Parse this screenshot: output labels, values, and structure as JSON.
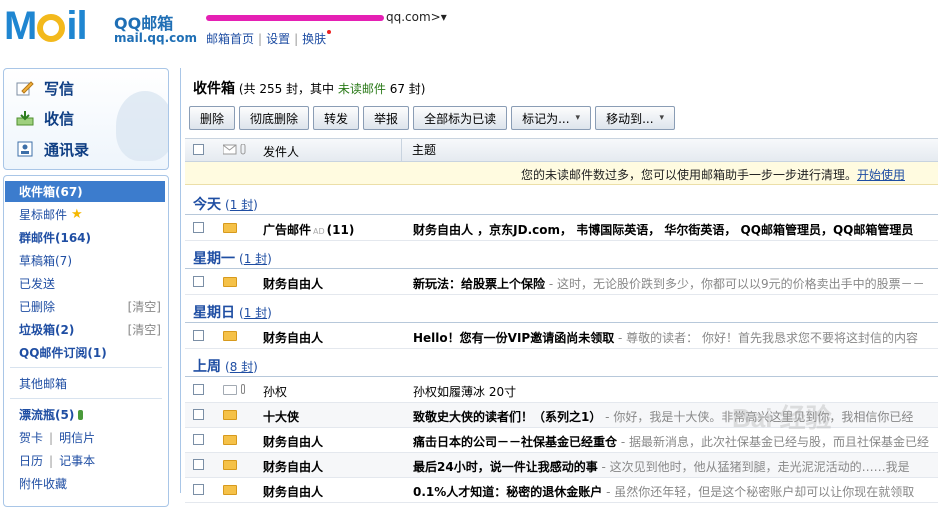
{
  "header": {
    "logo_text": "M  il",
    "logo_sub1": "QQ邮箱",
    "logo_sub2": "mail.qq.com",
    "account_suffix": "qq.com>",
    "account_caret": "▾",
    "links": [
      "邮箱首页",
      "设置",
      "换肤"
    ],
    "link_sep": "|"
  },
  "actions": [
    {
      "label": "写信",
      "icon": "pencil-icon"
    },
    {
      "label": "收信",
      "icon": "inbox-download-icon"
    },
    {
      "label": "通讯录",
      "icon": "address-book-icon"
    }
  ],
  "folders": {
    "inbox": "收件箱(67)",
    "starred": "星标邮件",
    "groups": "群邮件(164)",
    "drafts": "草稿箱(7)",
    "sent": "已发送",
    "deleted": "已删除",
    "spam": "垃圾箱(2)",
    "subscriptions": "QQ邮件订阅(1)",
    "other": "其他邮箱",
    "drift": "漂流瓶(5)",
    "card": "贺卡",
    "postcard": "明信片",
    "calendar": "日历",
    "notes": "记事本",
    "favorites": "附件收藏",
    "clear": "[清空]",
    "sep": "|"
  },
  "main": {
    "title": "收件箱",
    "count_prefix": "(共 255 封，其中",
    "unread_label": "未读邮件",
    "count_suffix": "67 封)"
  },
  "toolbar": {
    "delete": "删除",
    "perm_delete": "彻底删除",
    "forward": "转发",
    "report": "举报",
    "mark_all_read": "全部标为已读",
    "mark_as": "标记为...",
    "move_to": "移动到...",
    "caret": "▾"
  },
  "columns": {
    "sender": "发件人",
    "subject": "主题"
  },
  "notice": {
    "text": "您的未读邮件数过多，您可以使用邮箱助手一步一步进行清理。",
    "link": "开始使用"
  },
  "groups": [
    {
      "name": "今天",
      "count": "1 封"
    },
    {
      "name": "星期一",
      "count": "1 封"
    },
    {
      "name": "星期日",
      "count": "1 封"
    },
    {
      "name": "上周",
      "count": "8 封"
    }
  ],
  "emails": [
    {
      "sender": "广告邮件",
      "ad": "AD",
      "sender_count": "(11)",
      "subject": "财务自由人 ，京东JD.com， 韦博国际英语， 华尔街英语， QQ邮箱管理员，QQ邮箱管理员",
      "preview": ""
    },
    {
      "sender": "财务自由人",
      "subject": "新玩法：给股票上个保险",
      "preview": " - 这时，无论股价跌到多少，你都可以以9元的价格卖出手中的股票－－"
    },
    {
      "sender": "财务自由人",
      "subject": "Hello！您有一份VIP邀请函尚未领取",
      "preview": " - 尊敬的读者： 你好！首先我恳求您不要将这封信的内容"
    },
    {
      "sender": "孙权",
      "subject": "孙权如履薄冰 20寸",
      "preview": ""
    },
    {
      "sender": "十大侠",
      "subject": "致敬史大侠的读者们！（系列之1）",
      "preview": " - 你好，我是十大侠。非常高兴这里见到你，我相信你已经"
    },
    {
      "sender": "财务自由人",
      "subject": "痛击日本的公司－－社保基金已经重仓",
      "preview": " - 据最新消息，此次社保基金已经与股，而且社保基金已经"
    },
    {
      "sender": "财务自由人",
      "subject": "最后24小时，说一件让我感动的事",
      "preview": " - 这次见到他时，他从猛猪到腿，走光泥泥活动的……我是"
    },
    {
      "sender": "财务自由人",
      "subject": "0.1%人才知道：秘密的退休金账户",
      "preview": " - 虽然你还年轻，但是这个秘密账户却可以让你现在就领取"
    }
  ],
  "watermark": "Bai 经验"
}
